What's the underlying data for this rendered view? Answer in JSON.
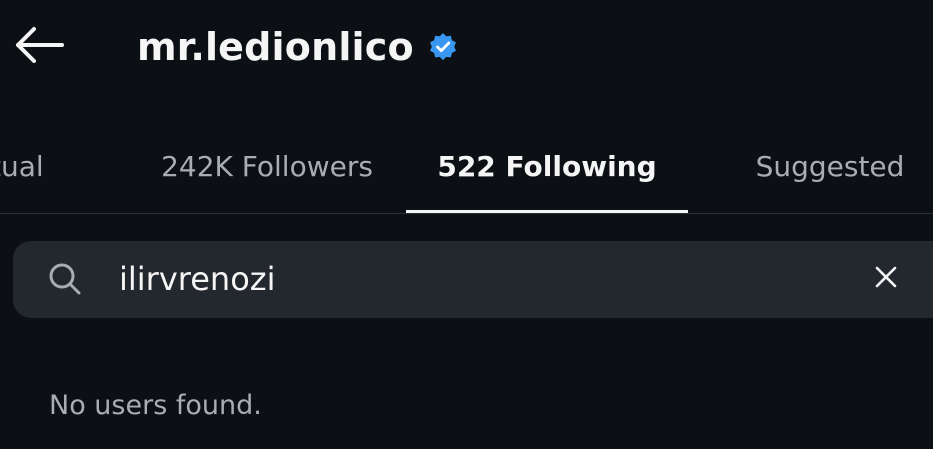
{
  "header": {
    "back_icon": "arrow-left-icon",
    "title": "mr.ledionlico",
    "verified_icon": "verified-badge-icon",
    "verified_color": "#3897f0"
  },
  "tabs": [
    {
      "label": "tual",
      "active": false
    },
    {
      "label": "242K Followers",
      "active": false
    },
    {
      "label": "522 Following",
      "active": true
    },
    {
      "label": "Suggested",
      "active": false
    }
  ],
  "search": {
    "icon": "search-icon",
    "value": "ilirvrenozi",
    "clear_icon": "close-icon"
  },
  "empty_state": {
    "message": "No users found."
  },
  "colors": {
    "background": "#0c0f14",
    "search_bg": "#23272e",
    "text_primary": "#f5f5f5",
    "text_secondary": "#a8adb4"
  }
}
